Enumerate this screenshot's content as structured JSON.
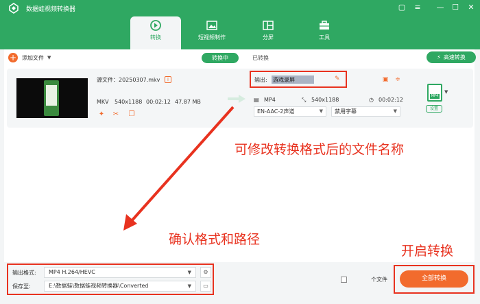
{
  "app": {
    "title": "数据蛙视频转换器",
    "window_controls": [
      "chat-icon",
      "menu-icon",
      "minimize-icon",
      "maximize-icon",
      "close-icon"
    ]
  },
  "nav": {
    "tabs": [
      {
        "label": "转换",
        "icon": "convert-icon",
        "active": true
      },
      {
        "label": "短视频制作",
        "icon": "video-make-icon",
        "active": false
      },
      {
        "label": "分屏",
        "icon": "split-screen-icon",
        "active": false
      },
      {
        "label": "工具",
        "icon": "toolbox-icon",
        "active": false
      }
    ]
  },
  "toolbar": {
    "add_file_label": "添加文件",
    "seg_converting": "转换中",
    "seg_converted": "已转换",
    "fast_convert_label": "高速转换"
  },
  "file_item": {
    "source_label": "源文件：20250307.mkv",
    "format": "MKV",
    "resolution": "540x1188",
    "duration": "00:02:12",
    "size": "47.87 MB",
    "output_label": "输出:",
    "output_name": "游戏录屏",
    "output_format": "MP4",
    "output_resolution": "540x1188",
    "output_duration": "00:02:12",
    "audio_track": "EN-AAC-2声道",
    "subtitle": "禁用字幕",
    "format_badge": "MP4",
    "settings_label": "设置"
  },
  "annotations": {
    "rename_tip": "可修改转换格式后的文件名称",
    "confirm_tip": "确认格式和路径",
    "start_tip": "开启转换"
  },
  "bottom": {
    "output_format_label": "输出格式:",
    "output_format_value": "MP4 H.264/HEVC",
    "save_to_label": "保存至:",
    "save_to_value": "E:\\数据蛙\\数据蛙视频转换器\\Converted",
    "merge_label": "个文件",
    "convert_all_label": "全部转换"
  },
  "colors": {
    "brand_green": "#2fa862",
    "accent_orange": "#f26b2d",
    "annotation_red": "#e8321f"
  }
}
